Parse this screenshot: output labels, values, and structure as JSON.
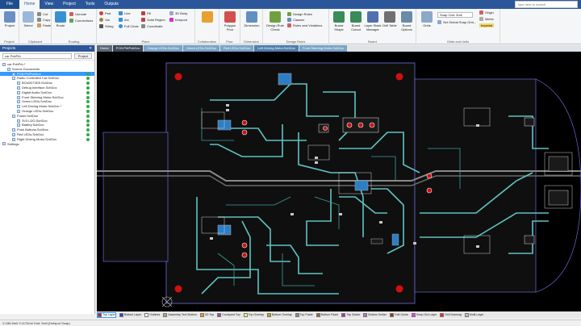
{
  "menu": {
    "tabs": [
      "File",
      "Home",
      "View",
      "Project",
      "Tools",
      "Outputs"
    ],
    "active_tab": "Home",
    "search_placeholder": "type here to search"
  },
  "ribbon": {
    "groups": [
      {
        "label": "Project",
        "big": [
          "Project"
        ]
      },
      {
        "label": "Clipboard",
        "big": [
          "Select",
          "Paste"
        ],
        "small": [
          "Cut",
          "Copy"
        ]
      },
      {
        "label": "Routing",
        "big": [
          "Route"
        ],
        "small": [
          "Unroute",
          "Connections"
        ]
      },
      {
        "label": "Place",
        "small": [
          "Pad",
          "Via",
          "String",
          "Line",
          "Arc",
          "Full Circle",
          "Fill",
          "Solid Region",
          "Coordinate",
          "3D Body",
          "Keepout"
        ]
      },
      {
        "label": "Collaboration",
        "big": [
          ""
        ]
      },
      {
        "label": "Pour",
        "big": [
          "Polygon Pour"
        ]
      },
      {
        "label": "Dimension",
        "big": [
          "Dimension"
        ]
      },
      {
        "label": "Design Rules",
        "big": [
          "Design Rule Check"
        ],
        "small": [
          "Design Rules",
          "Classes",
          "Rules and Violations"
        ]
      },
      {
        "label": "Board",
        "big": [
          "Board Shape",
          "Board Cutout",
          "Layer Stack Manager",
          "Drill Table",
          "Board Options"
        ]
      },
      {
        "label": "Grids and Units",
        "big": [
          "Grids"
        ],
        "small": [
          "Snap Grid: 5mil",
          "Set Global Snap Grid...",
          "Origin",
          "Metric",
          "Imperial"
        ]
      }
    ]
  },
  "projects_panel": {
    "title": "Projects",
    "search_value": "car PcbPrb",
    "project_button": "Project",
    "tree": [
      {
        "label": "car PcbPrb.*",
        "level": 0,
        "status": false,
        "selected": false
      },
      {
        "label": "Source Documents",
        "level": 1,
        "status": false,
        "selected": false
      },
      {
        "label": "PCB.PWPcbDoc",
        "level": 2,
        "status": true,
        "selected": true
      },
      {
        "label": "Radio Controlled Car.SchDoc",
        "level": 2,
        "status": true,
        "selected": false
      },
      {
        "label": "BCM2073D5.SchDoc",
        "level": 3,
        "status": true,
        "selected": false
      },
      {
        "label": "Debug Interface.SchDoc",
        "level": 3,
        "status": true,
        "selected": false
      },
      {
        "label": "Digital Audio.SchDoc",
        "level": 3,
        "status": true,
        "selected": false
      },
      {
        "label": "Front Steering Motor.SchDoc",
        "level": 3,
        "status": true,
        "selected": false
      },
      {
        "label": "Green LEDs.SchDoc",
        "level": 3,
        "status": true,
        "selected": false
      },
      {
        "label": "Left Driving Motor.SchDoc *",
        "level": 3,
        "status": true,
        "selected": false
      },
      {
        "label": "Orange LEDs.SchDoc",
        "level": 3,
        "status": true,
        "selected": false
      },
      {
        "label": "Power.SchDoc",
        "level": 2,
        "status": true,
        "selected": false
      },
      {
        "label": "3V3 LDO.SchDoc",
        "level": 3,
        "status": true,
        "selected": false
      },
      {
        "label": "Battery.SchDoc",
        "level": 3,
        "status": true,
        "selected": false
      },
      {
        "label": "Push Buttons.SchDoc",
        "level": 2,
        "status": true,
        "selected": false
      },
      {
        "label": "Red LEDs.SchDoc",
        "level": 2,
        "status": true,
        "selected": false
      },
      {
        "label": "Right Driving Motor.SchDoc",
        "level": 2,
        "status": true,
        "selected": false
      },
      {
        "label": "Settings",
        "level": 0,
        "status": false,
        "selected": false
      }
    ]
  },
  "doc_tabs": [
    {
      "label": "Home",
      "color": "#5b6b7b"
    },
    {
      "label": "PCB.PWPcbDoc",
      "color": "#3a4a5a"
    },
    {
      "label": "Orange LEDs.SchDoc",
      "color": "#7aa4c8"
    },
    {
      "label": "Green LEDs.SchDoc",
      "color": "#7aa4c8"
    },
    {
      "label": "Red LEDs.SchDoc",
      "color": "#7aa4c8"
    },
    {
      "label": "Left Driving Motor.SchDoc",
      "color": "#4f7fad"
    },
    {
      "label": "Front Steering Motor.SchDoc",
      "color": "#7aa4c8"
    }
  ],
  "layers": [
    {
      "label": "Top Layer",
      "color": "#cc2222",
      "active": true
    },
    {
      "label": "Bottom Layer",
      "color": "#2244cc",
      "active": false
    },
    {
      "label": "Outlines",
      "color": "#ffffff",
      "active": false
    },
    {
      "label": "Assembly Text Bottom",
      "color": "#aaaa66",
      "active": false
    },
    {
      "label": "3D Top",
      "color": "#ff9900",
      "active": false
    },
    {
      "label": "Courtyard Top",
      "color": "#aa44aa",
      "active": false
    },
    {
      "label": "Top Overlay",
      "color": "#ffff66",
      "active": false
    },
    {
      "label": "Bottom Overlay",
      "color": "#cc9900",
      "active": false
    },
    {
      "label": "Top Paste",
      "color": "#888888",
      "active": false
    },
    {
      "label": "Bottom Paste",
      "color": "#996633",
      "active": false
    },
    {
      "label": "Top Solder",
      "color": "#aa33aa",
      "active": false
    },
    {
      "label": "Bottom Solder",
      "color": "#cc66cc",
      "active": false
    },
    {
      "label": "Drill Guide",
      "color": "#993300",
      "active": false
    },
    {
      "label": "Keep-Out Layer",
      "color": "#ff33ff",
      "active": false
    },
    {
      "label": "Drill Drawing",
      "color": "#ff2222",
      "active": false
    },
    {
      "label": "Multi-Layer",
      "color": "#c0c0c0",
      "active": false
    }
  ],
  "status": {
    "text": "X:186.9mil Y:4170mil    Grid: 5mil    (Hotspot Snap)"
  },
  "colors": {
    "trace": "#5fc4c4",
    "board": "#0d0d0d",
    "outline": "#8888ff",
    "pad_red": "#d01010",
    "component": "#2d7ec4",
    "accent": "#2b579a"
  }
}
